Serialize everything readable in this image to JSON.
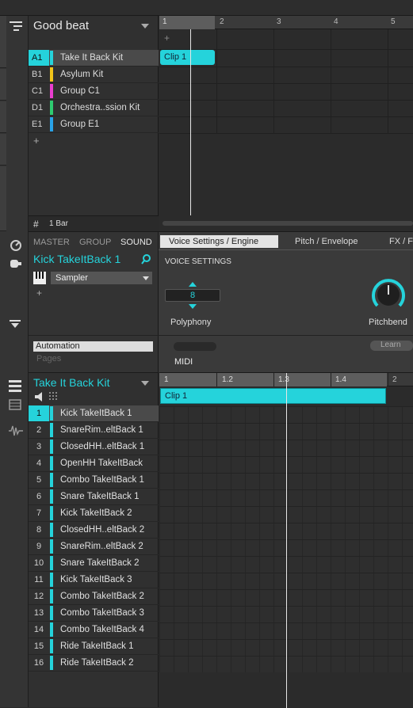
{
  "group_panel": {
    "title": "Good beat",
    "groups": [
      {
        "id": "A1",
        "name": "Take It Back Kit",
        "color": "#25d3db",
        "selected": true
      },
      {
        "id": "B1",
        "name": "Asylum Kit",
        "color": "#f0c419",
        "selected": false
      },
      {
        "id": "C1",
        "name": "Group C1",
        "color": "#e93ecf",
        "selected": false
      },
      {
        "id": "D1",
        "name": "Orchestra..ssion Kit",
        "color": "#2ecc71",
        "selected": false
      },
      {
        "id": "E1",
        "name": "Group E1",
        "color": "#29a3e8",
        "selected": false
      }
    ],
    "add_label": "+",
    "bar_length": "1 Bar"
  },
  "arranger": {
    "ruler": [
      "1",
      "2",
      "3",
      "4",
      "5"
    ],
    "add_label": "+",
    "clip_label": "Clip 1"
  },
  "sound_panel": {
    "tabs": [
      "MASTER",
      "GROUP",
      "SOUND"
    ],
    "sound_name": "Kick TakeItBack 1",
    "plugin": "Sampler",
    "add_label": "+",
    "page_tabs": [
      "Voice Settings / Engine",
      "Pitch / Envelope",
      "FX / F"
    ],
    "section_title": "VOICE SETTINGS",
    "polyphony_value": "8",
    "polyphony_label": "Polyphony",
    "pitchbend_label": "Pitchbend",
    "automation_label": "Automation",
    "pages_label": "Pages",
    "midi_label": "MIDI",
    "learn_label": "Learn"
  },
  "pattern": {
    "group_name": "Take It Back Kit",
    "ruler": [
      "1",
      "1.2",
      "1.3",
      "1.4",
      "2"
    ],
    "clip_label": "Clip 1",
    "sounds": [
      {
        "num": "1",
        "name": "Kick TakeItBack 1"
      },
      {
        "num": "2",
        "name": "SnareRim..eltBack 1"
      },
      {
        "num": "3",
        "name": "ClosedHH..eltBack 1"
      },
      {
        "num": "4",
        "name": "OpenHH TakeItBack"
      },
      {
        "num": "5",
        "name": "Combo TakeItBack 1"
      },
      {
        "num": "6",
        "name": "Snare TakeItBack 1"
      },
      {
        "num": "7",
        "name": "Kick TakeItBack 2"
      },
      {
        "num": "8",
        "name": "ClosedHH..eltBack 2"
      },
      {
        "num": "9",
        "name": "SnareRim..eltBack 2"
      },
      {
        "num": "10",
        "name": "Snare TakeItBack 2"
      },
      {
        "num": "11",
        "name": "Kick TakeItBack 3"
      },
      {
        "num": "12",
        "name": "Combo TakeItBack 2"
      },
      {
        "num": "13",
        "name": "Combo TakeItBack 3"
      },
      {
        "num": "14",
        "name": "Combo TakeItBack 4"
      },
      {
        "num": "15",
        "name": "Ride TakeItBack 1"
      },
      {
        "num": "16",
        "name": "Ride TakeItBack 2"
      }
    ]
  },
  "colors": {
    "accent": "#25d3db"
  }
}
